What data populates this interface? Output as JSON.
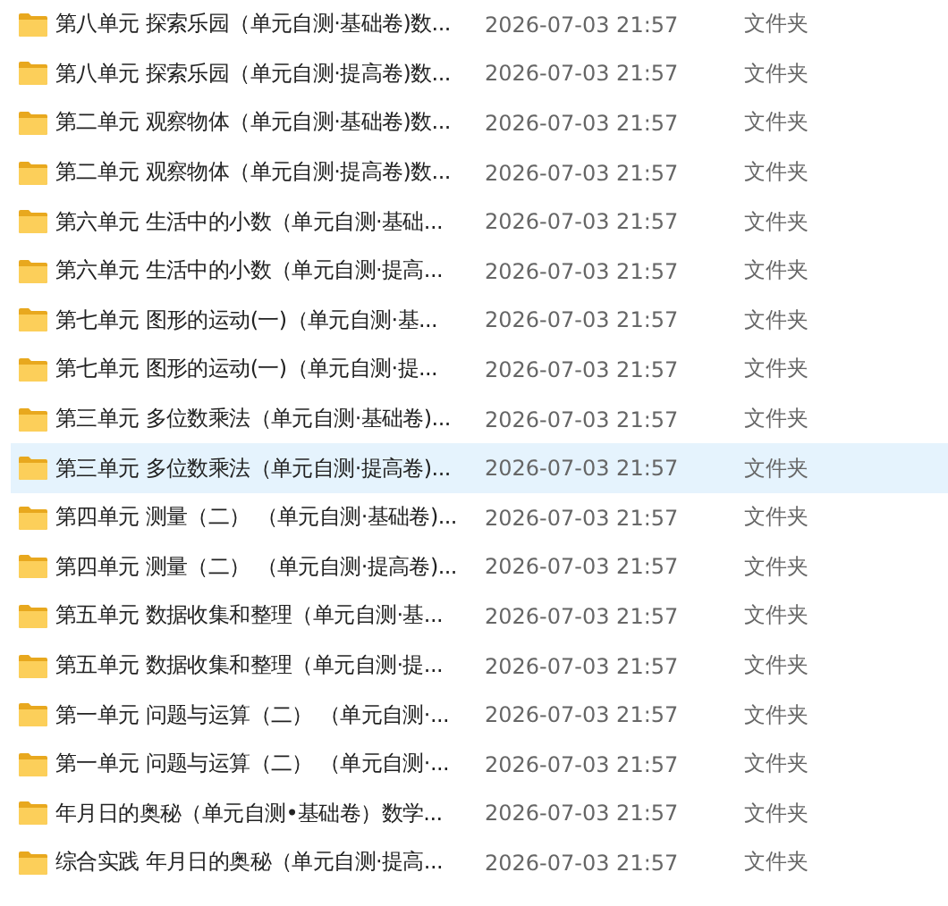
{
  "files": [
    {
      "name": "第八单元 探索乐园（单元自测·基础卷)数...",
      "modified": "2026-07-03 21:57",
      "type": "文件夹",
      "selected": false
    },
    {
      "name": "第八单元 探索乐园（单元自测·提高卷)数...",
      "modified": "2026-07-03 21:57",
      "type": "文件夹",
      "selected": false
    },
    {
      "name": "第二单元 观察物体（单元自测·基础卷)数...",
      "modified": "2026-07-03 21:57",
      "type": "文件夹",
      "selected": false
    },
    {
      "name": "第二单元 观察物体（单元自测·提高卷)数...",
      "modified": "2026-07-03 21:57",
      "type": "文件夹",
      "selected": false
    },
    {
      "name": "第六单元 生活中的小数（单元自测·基础...",
      "modified": "2026-07-03 21:57",
      "type": "文件夹",
      "selected": false
    },
    {
      "name": "第六单元 生活中的小数（单元自测·提高...",
      "modified": "2026-07-03 21:57",
      "type": "文件夹",
      "selected": false
    },
    {
      "name": "第七单元 图形的运动(一)（单元自测·基...",
      "modified": "2026-07-03 21:57",
      "type": "文件夹",
      "selected": false
    },
    {
      "name": "第七单元 图形的运动(一)（单元自测·提...",
      "modified": "2026-07-03 21:57",
      "type": "文件夹",
      "selected": false
    },
    {
      "name": "第三单元 多位数乘法（单元自测·基础卷)...",
      "modified": "2026-07-03 21:57",
      "type": "文件夹",
      "selected": false
    },
    {
      "name": "第三单元 多位数乘法（单元自测·提高卷)...",
      "modified": "2026-07-03 21:57",
      "type": "文件夹",
      "selected": true
    },
    {
      "name": "第四单元 测量（二） （单元自测·基础卷)...",
      "modified": "2026-07-03 21:57",
      "type": "文件夹",
      "selected": false
    },
    {
      "name": "第四单元 测量（二） （单元自测·提高卷)...",
      "modified": "2026-07-03 21:57",
      "type": "文件夹",
      "selected": false
    },
    {
      "name": "第五单元 数据收集和整理（单元自测·基...",
      "modified": "2026-07-03 21:57",
      "type": "文件夹",
      "selected": false
    },
    {
      "name": "第五单元 数据收集和整理（单元自测·提...",
      "modified": "2026-07-03 21:57",
      "type": "文件夹",
      "selected": false
    },
    {
      "name": "第一单元 问题与运算（二） （单元自测·...",
      "modified": "2026-07-03 21:57",
      "type": "文件夹",
      "selected": false
    },
    {
      "name": "第一单元 问题与运算（二） （单元自测·...",
      "modified": "2026-07-03 21:57",
      "type": "文件夹",
      "selected": false
    },
    {
      "name": "年月日的奥秘（单元自测•基础卷）数学...",
      "modified": "2026-07-03 21:57",
      "type": "文件夹",
      "selected": false
    },
    {
      "name": "综合实践 年月日的奥秘（单元自测·提高...",
      "modified": "2026-07-03 21:57",
      "type": "文件夹",
      "selected": false
    }
  ]
}
